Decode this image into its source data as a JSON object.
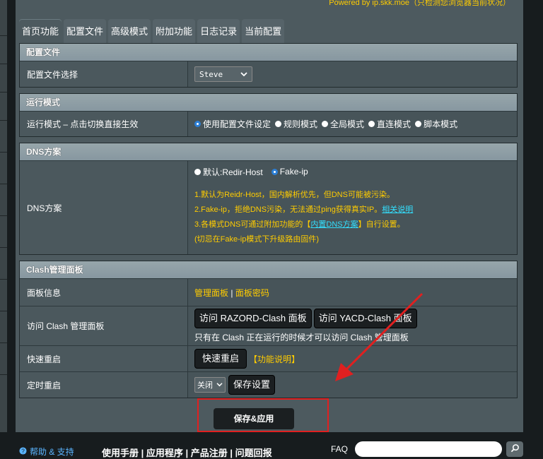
{
  "powered_by": "Powered by ip.skk.moe（只检测您浏览器当前状况）",
  "tabs": [
    "首页功能",
    "配置文件",
    "高级模式",
    "附加功能",
    "日志记录",
    "当前配置"
  ],
  "config": {
    "section_title": "配置文件",
    "label": "配置文件选择",
    "selected": "Steve"
  },
  "mode": {
    "section_title": "运行模式",
    "label": "运行模式 – 点击切换直接生效",
    "options": [
      "使用配置文件设定",
      "规则模式",
      "全局模式",
      "直连模式",
      "脚本模式"
    ],
    "selected_index": 0
  },
  "dns": {
    "section_title": "DNS方案",
    "label": "DNS方案",
    "options": [
      "默认:Redir-Host",
      "Fake-ip"
    ],
    "selected_index": 1,
    "note1": "1.默认为Reidr-Host，国内解析优先，但DNS可能被污染。",
    "note2_prefix": "2.Fake-ip，拒绝DNS污染，无法通过ping获得真实IP。",
    "note2_link": "相关说明",
    "note3_prefix": "3.各模式DNS可通过附加功能的【",
    "note3_link": "内置DNS方案",
    "note3_suffix": "】自行设置。",
    "note4": "(切忌在Fake-ip模式下升级路由固件)"
  },
  "clash": {
    "section_title": "Clash管理面板",
    "info_label": "面板信息",
    "info_link1": "管理面板",
    "info_sep": " | ",
    "info_link2": "面板密码",
    "visit_label": "访问 Clash 管理面板",
    "btn_razord": "访问 RAZORD-Clash 面板",
    "btn_yacd": "访问 YACD-Clash 面板",
    "visit_note": "只有在 Clash 正在运行的时候才可以访问 Clash 管理面板",
    "restart_label": "快速重启",
    "restart_btn": "快速重启",
    "restart_note": "【功能说明】",
    "timer_label": "定时重启",
    "timer_select": "关闭",
    "timer_save": "保存设置"
  },
  "apply_btn": "保存&应用",
  "footer": {
    "help": "帮助 & 支持",
    "links": "使用手册 | 应用程序 | 产品注册 | 问题回报",
    "faq": "FAQ"
  }
}
